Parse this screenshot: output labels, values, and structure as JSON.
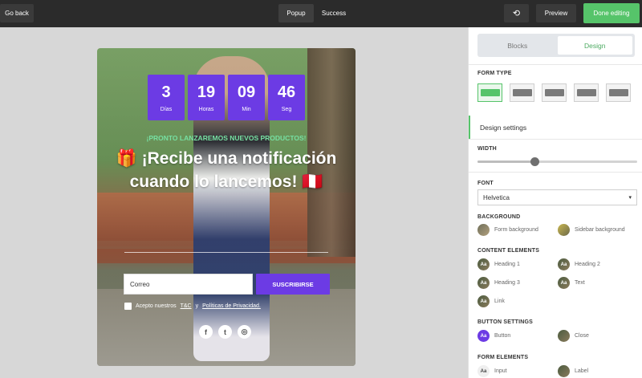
{
  "topbar": {
    "go_back": "Go back",
    "tabs": [
      "Popup",
      "Success"
    ],
    "preview": "Preview",
    "done": "Done editing"
  },
  "popup": {
    "timer": [
      {
        "value": "3",
        "label": "Días"
      },
      {
        "value": "19",
        "label": "Horas"
      },
      {
        "value": "09",
        "label": "Min"
      },
      {
        "value": "46",
        "label": "Seg"
      }
    ],
    "kicker": "¡PRONTO LANZAREMOS NUEVOS PRODUCTOS!",
    "headline": "🎁 ¡Recibe una notificación cuando lo lancemos! 🇵🇪",
    "email_placeholder": "Correo",
    "subscribe": "SUSCRIBIRSE",
    "consent_prefix": "Acepto nuestros",
    "consent_tc": "T&C",
    "consent_mid": "y",
    "consent_privacy": "Políticas de Privacidad."
  },
  "panel": {
    "tabs": [
      "Blocks",
      "Design"
    ],
    "form_type_title": "FORM TYPE",
    "design_settings": "Design settings",
    "width_title": "WIDTH",
    "width_value": 0.36,
    "font_title": "FONT",
    "font_value": "Helvetica",
    "background_title": "BACKGROUND",
    "background_items": [
      "Form background",
      "Sidebar background"
    ],
    "content_title": "CONTENT ELEMENTS",
    "content_items": [
      "Heading 1",
      "Heading 2",
      "Heading 3",
      "Text",
      "Link"
    ],
    "button_title": "BUTTON SETTINGS",
    "button_items": [
      "Button",
      "Close"
    ],
    "form_elements_title": "FORM ELEMENTS",
    "form_items": [
      "Input",
      "Label"
    ]
  },
  "colors": {
    "accent_green": "#56c46a",
    "purple": "#6c3be4"
  }
}
